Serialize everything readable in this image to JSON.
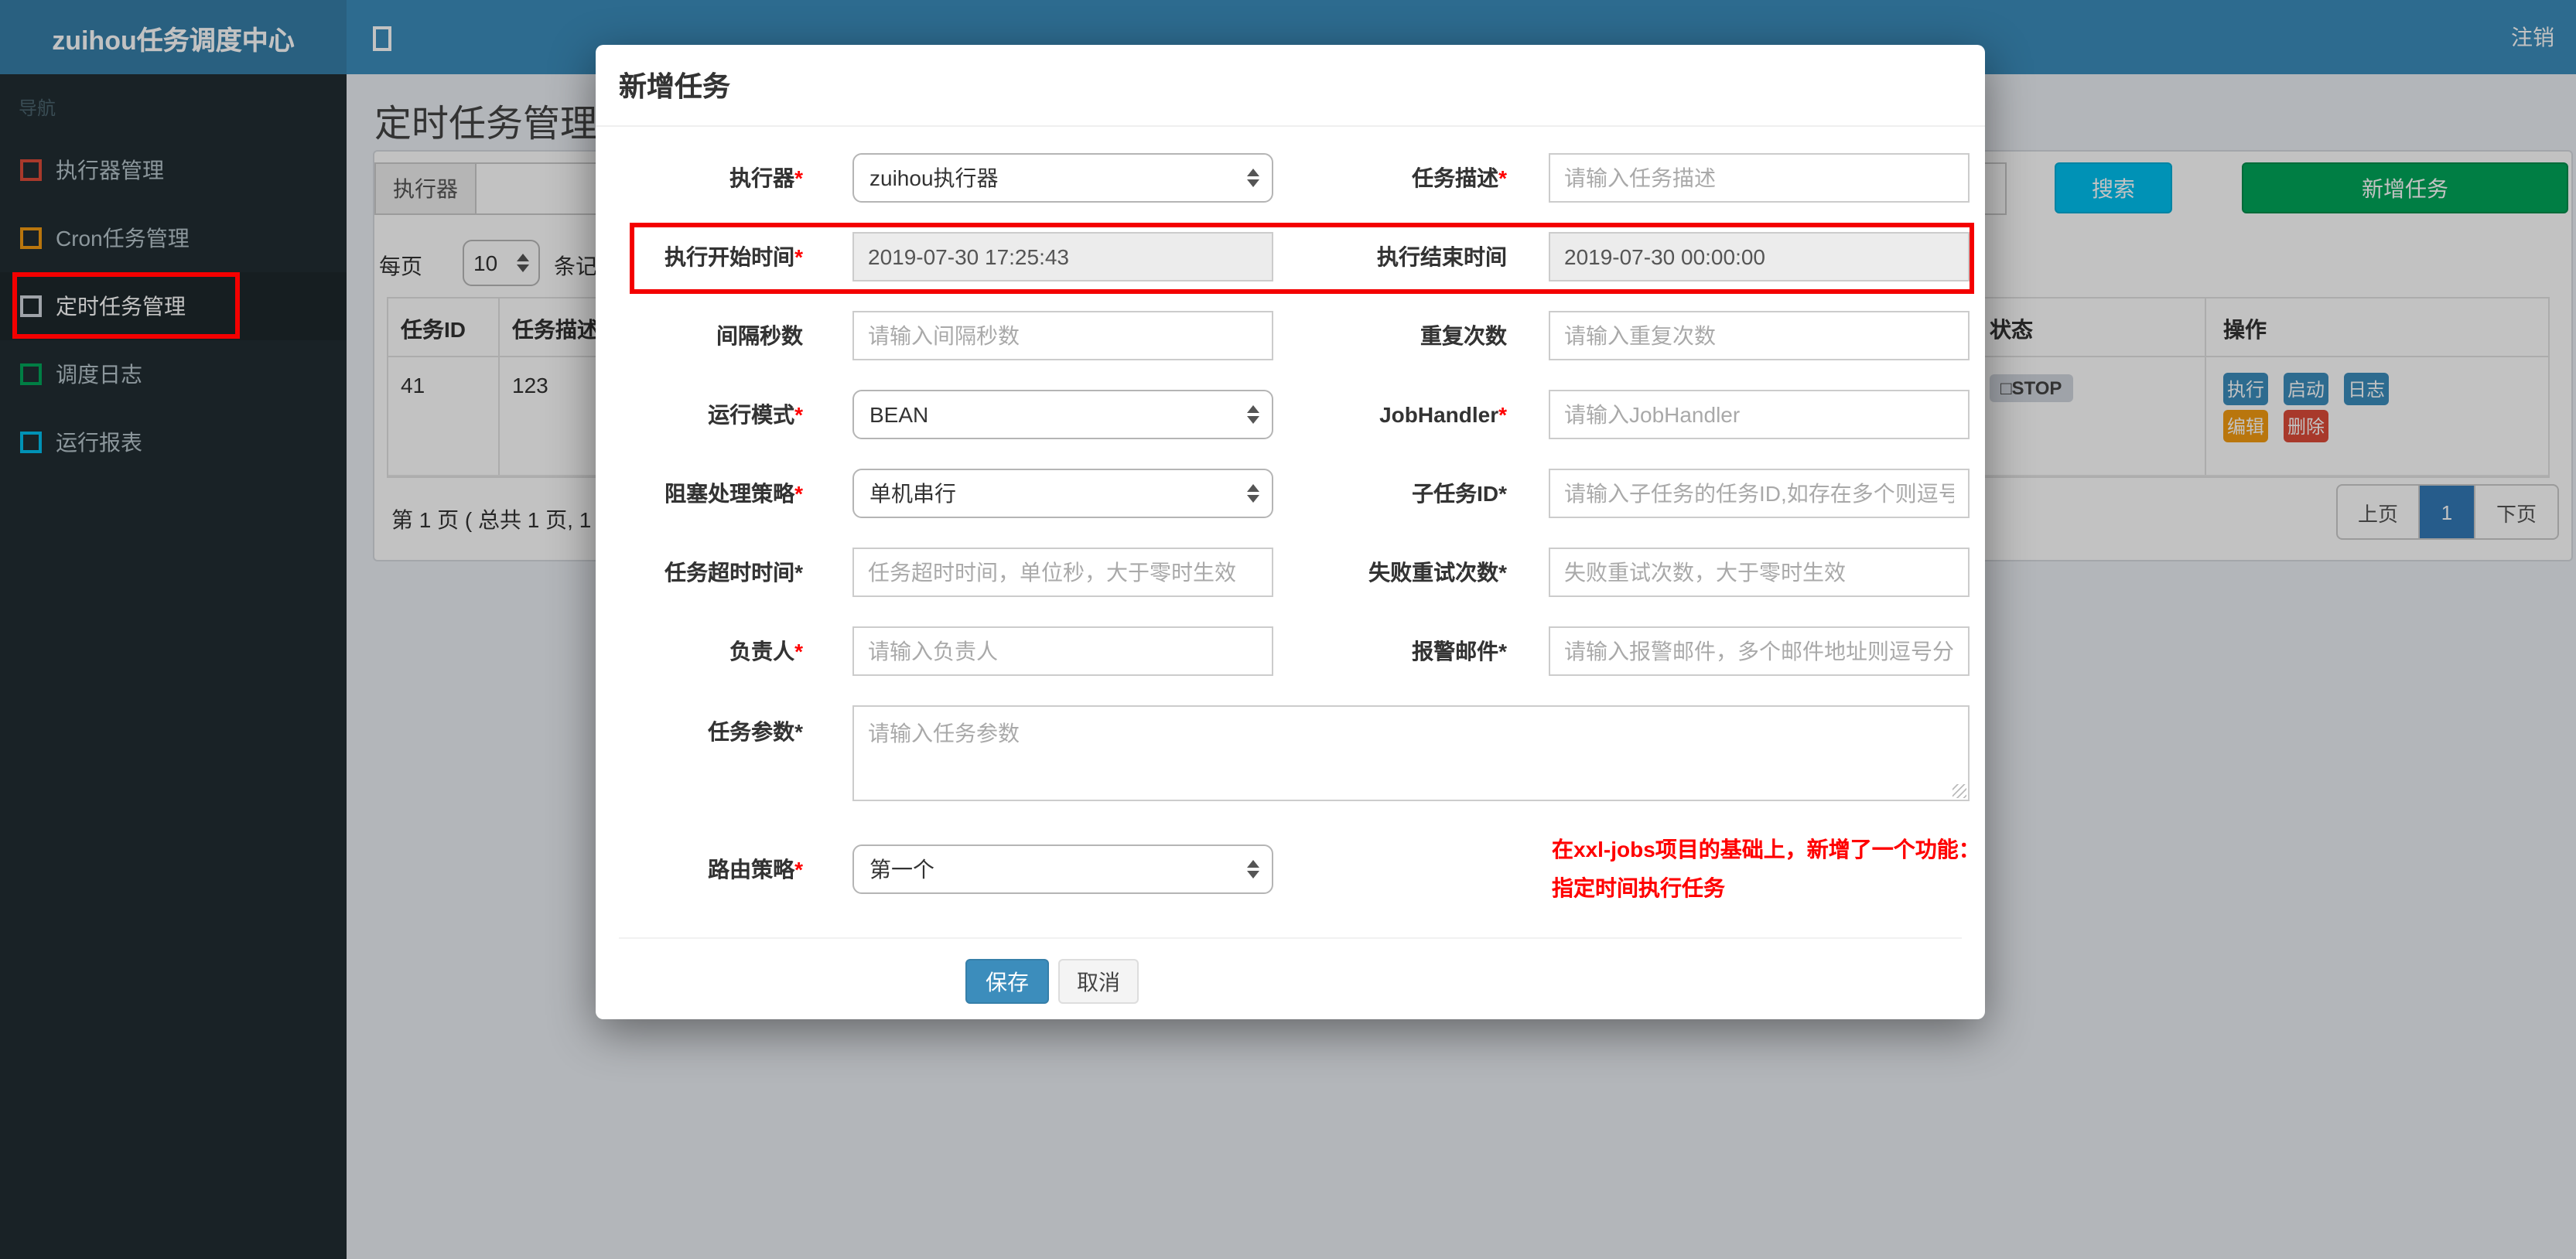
{
  "colors": {
    "header_bg": "#3c8dbc",
    "logo_bg": "#367fa9",
    "sidebar_bg": "#222d32",
    "content_bg": "#ecf0f5",
    "accent_info": "#00c0ef",
    "accent_success": "#00a65a",
    "accent_primary": "#3c8dbc",
    "accent_warning": "#f39c12",
    "accent_danger": "#dd4b39",
    "pager_active": "#337ab7",
    "annotation_red": "#f40000"
  },
  "header": {
    "brand": "zuihou任务调度中心",
    "toggle_icon": "square-outline-icon",
    "logout": "注销"
  },
  "sidebar": {
    "section_label": "导航",
    "items": [
      {
        "label": "执行器管理",
        "icon_color": "#dd4b39"
      },
      {
        "label": "Cron任务管理",
        "icon_color": "#f39c12"
      },
      {
        "label": "定时任务管理",
        "icon_color": "#d2d6de",
        "active": true
      },
      {
        "label": "调度日志",
        "icon_color": "#00a65a"
      },
      {
        "label": "运行报表",
        "icon_color": "#00c0ef"
      }
    ]
  },
  "page": {
    "title": "定时任务管理",
    "toolbar": {
      "filter_addon": "执行器",
      "search_label": "搜索",
      "add_label": "新增任务"
    },
    "perpage": {
      "prefix": "每页",
      "value": "10",
      "suffix": "条记"
    },
    "table": {
      "headers": [
        "任务ID",
        "任务描述",
        "状态",
        "操作"
      ],
      "row": {
        "job_id": "41",
        "job_desc": "123",
        "status": "□STOP",
        "actions": [
          "执行",
          "启动",
          "日志",
          "编辑",
          "删除"
        ]
      }
    },
    "pagination": {
      "info": "第 1 页 ( 总共 1 页, 1",
      "prev": "上页",
      "current": "1",
      "next": "下页"
    }
  },
  "modal": {
    "title": "新增任务",
    "rows": [
      {
        "left": {
          "label": "执行器",
          "star": "*",
          "star_class": "star red",
          "value": "zuihou执行器"
        },
        "right": {
          "label": "任务描述",
          "star": "*",
          "star_class": "star red",
          "placeholder": "请输入任务描述"
        }
      },
      {
        "left": {
          "label": "执行开始时间",
          "star": "*",
          "star_class": "star red",
          "value": "2019-07-30 17:25:43"
        },
        "right": {
          "label": "执行结束时间",
          "star": "",
          "star_class": "star",
          "value": "2019-07-30 00:00:00"
        }
      },
      {
        "left": {
          "label": "间隔秒数",
          "star": "",
          "star_class": "star",
          "placeholder": "请输入间隔秒数"
        },
        "right": {
          "label": "重复次数",
          "star": "",
          "star_class": "star",
          "placeholder": "请输入重复次数"
        }
      },
      {
        "left": {
          "label": "运行模式",
          "star": "*",
          "star_class": "star red",
          "value": "BEAN"
        },
        "right": {
          "label": "JobHandler",
          "star": "*",
          "star_class": "star red",
          "placeholder": "请输入JobHandler"
        }
      },
      {
        "left": {
          "label": "阻塞处理策略",
          "star": "*",
          "star_class": "star red",
          "value": "单机串行"
        },
        "right": {
          "label": "子任务ID",
          "star": "*",
          "star_class": "star dark",
          "placeholder": "请输入子任务的任务ID,如存在多个则逗号分隔"
        }
      },
      {
        "left": {
          "label": "任务超时时间",
          "star": "*",
          "star_class": "star dark",
          "placeholder": "任务超时时间，单位秒，大于零时生效"
        },
        "right": {
          "label": "失败重试次数",
          "star": "*",
          "star_class": "star dark",
          "placeholder": "失败重试次数，大于零时生效"
        }
      },
      {
        "left": {
          "label": "负责人",
          "star": "*",
          "star_class": "star red",
          "placeholder": "请输入负责人"
        },
        "right": {
          "label": "报警邮件",
          "star": "*",
          "star_class": "star dark",
          "placeholder": "请输入报警邮件，多个邮件地址则逗号分隔"
        }
      }
    ],
    "params": {
      "label": "任务参数",
      "star": "*",
      "star_class": "star dark",
      "placeholder": "请输入任务参数"
    },
    "route": {
      "label": "路由策略",
      "star": "*",
      "star_class": "star red",
      "value": "第一个"
    },
    "note_line1": "在xxl-jobs项目的基础上，新增了一个功能：",
    "note_line2": "指定时间执行任务",
    "save_label": "保存",
    "cancel_label": "取消"
  }
}
